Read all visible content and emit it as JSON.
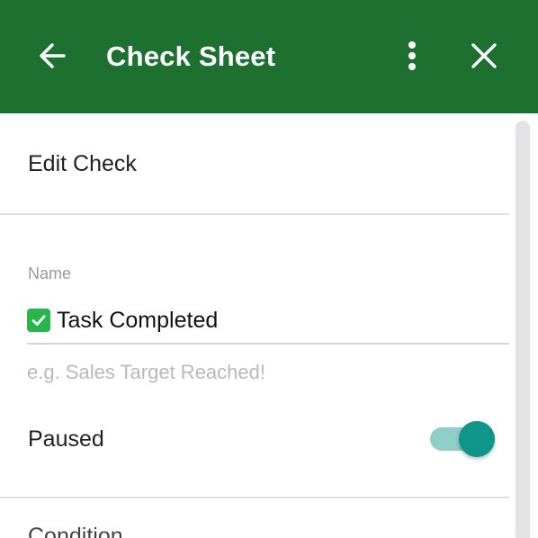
{
  "header": {
    "title": "Check Sheet",
    "background_color": "#1d7030",
    "back_icon": "arrow-left-icon",
    "more_icon": "more-vertical-icon",
    "close_icon": "close-icon"
  },
  "form": {
    "section_title": "Edit Check",
    "name_field": {
      "label": "Name",
      "emoji_icon": "green-checkmark-icon",
      "value": "Task Completed",
      "hint": "e.g. Sales Target Reached!"
    },
    "paused": {
      "label": "Paused",
      "enabled": true,
      "accent_color": "#0f968a"
    },
    "condition_label": "Condition"
  }
}
